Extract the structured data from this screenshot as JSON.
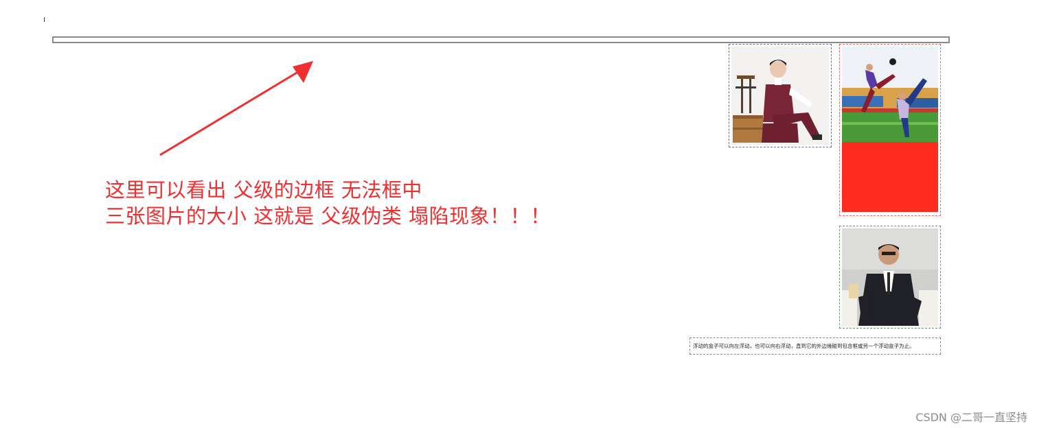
{
  "annotation": {
    "line1": "这里可以看出 父级的边框 无法框中",
    "line2": "三张图片的大小 这就是 父级伪类 塌陷现象！！！"
  },
  "caption": {
    "text": "浮动的盒子可以向左浮动，也可以向右浮动，直到它的外边缘碰到包含框或另一个浮动盒子为止。"
  },
  "watermark": {
    "text": "CSDN @二哥一直坚持"
  },
  "colors": {
    "annotation_red": "#f03030",
    "arrow_red": "#f03030",
    "block_red": "#ff2d1f"
  }
}
